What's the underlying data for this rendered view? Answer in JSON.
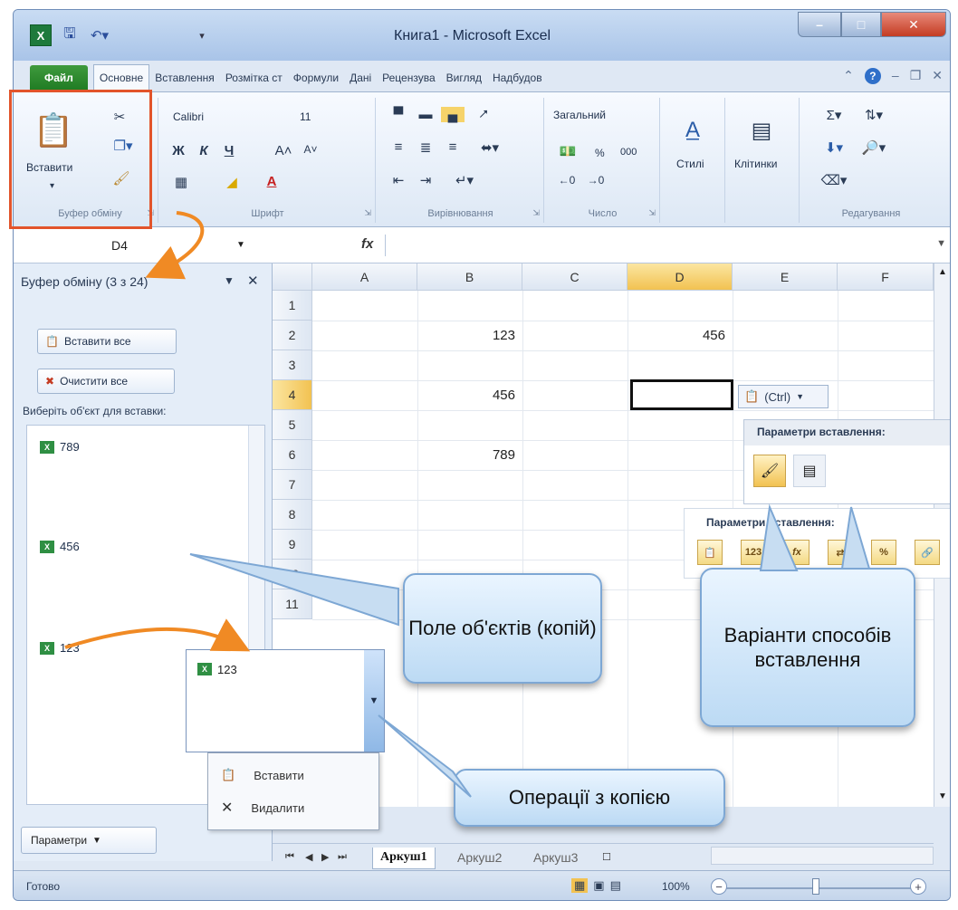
{
  "window": {
    "title": "Книга1 - Microsoft Excel",
    "app_icon": "X"
  },
  "tabs": [
    {
      "label": "Файл"
    },
    {
      "label": "Основне"
    },
    {
      "label": "Вставлення"
    },
    {
      "label": "Розмітка ст"
    },
    {
      "label": "Формули"
    },
    {
      "label": "Дані"
    },
    {
      "label": "Рецензува"
    },
    {
      "label": "Вигляд"
    },
    {
      "label": "Надбудов"
    }
  ],
  "ribbon": {
    "clipboard": {
      "paste_label": "Вставити",
      "group_label": "Буфер обміну"
    },
    "font": {
      "name": "Calibri",
      "size": "11",
      "group_label": "Шрифт"
    },
    "alignment": {
      "group_label": "Вирівнювання"
    },
    "number": {
      "format": "Загальний",
      "group_label": "Число",
      "percent": "%",
      "thousands": "000"
    },
    "styles": {
      "label": "Стилі"
    },
    "cells": {
      "label": "Клітинки"
    },
    "editing": {
      "group_label": "Редагування"
    }
  },
  "formula_bar": {
    "name_box": "D4",
    "fx": "fx",
    "value": ""
  },
  "clipboard_pane": {
    "title": "Буфер обміну (3 з 24)",
    "paste_all": "Вставити все",
    "clear_all": "Очистити все",
    "hint": "Виберіть об'єкт для вставки:",
    "items": [
      {
        "text": "789"
      },
      {
        "text": "456"
      },
      {
        "text": "123"
      }
    ],
    "options": "Параметри"
  },
  "item_popup": {
    "text": "123"
  },
  "context_menu": {
    "paste": "Вставити",
    "delete": "Видалити"
  },
  "grid": {
    "columns": [
      "A",
      "B",
      "C",
      "D",
      "E",
      "F"
    ],
    "rows": [
      "1",
      "2",
      "3",
      "4",
      "5",
      "6",
      "7",
      "8",
      "9",
      "10",
      "11"
    ],
    "cells": {
      "B2": "123",
      "D2": "456",
      "B4": "456",
      "B6": "789"
    },
    "active_cell": "D4"
  },
  "paste_smart_tag": {
    "label": "(Ctrl)"
  },
  "paste_menu": {
    "title": "Параметри вставлення:"
  },
  "paste_options_2": {
    "title": "Параметри вставлення:",
    "icon_123": "123",
    "icon_fx": "fx",
    "icon_percent": "%"
  },
  "sheets": [
    {
      "name": "Аркуш1",
      "active": true
    },
    {
      "name": "Аркуш2"
    },
    {
      "name": "Аркуш3"
    }
  ],
  "status": {
    "text": "Готово",
    "zoom": "100%"
  },
  "callouts": {
    "objects": "Поле об'єктів (копій)",
    "variants": "Варіанти способів вставлення",
    "operations": "Операції з копією"
  },
  "colors": {
    "highlight_frame": "#e2542b",
    "arrow": "#f08a24",
    "selection": "#f2c251"
  }
}
